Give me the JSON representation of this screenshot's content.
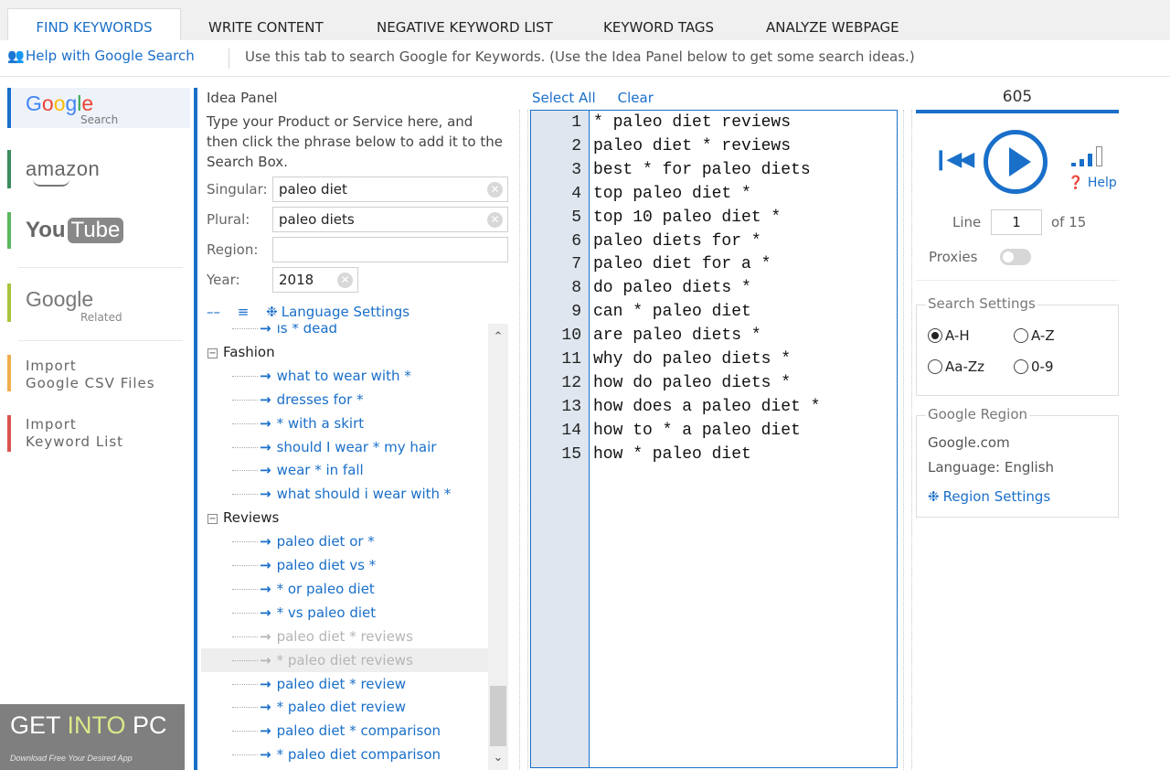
{
  "tabs": [
    "FIND KEYWORDS",
    "WRITE CONTENT",
    "NEGATIVE KEYWORD LIST",
    "KEYWORD TAGS",
    "ANALYZE WEBPAGE"
  ],
  "help": {
    "link": "Help with Google Search",
    "hint": "Use this tab to search Google for Keywords. (Use the Idea Panel below to get some search ideas.)"
  },
  "nav": {
    "google_sub": "Search",
    "amazon": "amazon",
    "youtube_you": "You",
    "youtube_tube": "Tube",
    "google_related": "Google",
    "google_related_sub": "Related",
    "import_csv": "Import\nGoogle CSV Files",
    "import_list": "Import\nKeyword List",
    "colors": {
      "google": "#1a6fc9",
      "amazon": "#3a8c5c",
      "youtube": "#5cb85c",
      "related": "#a8c43a",
      "csv": "#f0ad4e",
      "list": "#d9534f"
    }
  },
  "watermark": {
    "get": "GET ",
    "into": "INTO",
    "pc": " PC",
    "sub": "Download Free Your Desired App"
  },
  "idea_panel": {
    "title": "Idea Panel",
    "description": "Type your Product or Service here, and then click the phrase below to add it to the Search Box.",
    "singular_label": "Singular:",
    "singular_value": "paleo diet",
    "plural_label": "Plural:",
    "plural_value": "paleo diets",
    "region_label": "Region:",
    "region_value": "",
    "year_label": "Year:",
    "year_value": "2018",
    "language_settings": "Language Settings",
    "tree": [
      {
        "kind": "leaf",
        "text": "is * dead",
        "dim": false
      },
      {
        "kind": "cat",
        "text": "Fashion"
      },
      {
        "kind": "leaf",
        "text": "what to wear with *",
        "dim": false
      },
      {
        "kind": "leaf",
        "text": "dresses for *",
        "dim": false
      },
      {
        "kind": "leaf",
        "text": "* with a skirt",
        "dim": false
      },
      {
        "kind": "leaf",
        "text": "should I wear * my hair",
        "dim": false
      },
      {
        "kind": "leaf",
        "text": "wear * in fall",
        "dim": false
      },
      {
        "kind": "leaf",
        "text": "what should i wear with *",
        "dim": false
      },
      {
        "kind": "cat",
        "text": "Reviews"
      },
      {
        "kind": "leaf",
        "text": "paleo diet or *",
        "dim": false
      },
      {
        "kind": "leaf",
        "text": "paleo diet vs *",
        "dim": false
      },
      {
        "kind": "leaf",
        "text": "* or paleo diet",
        "dim": false
      },
      {
        "kind": "leaf",
        "text": "* vs paleo diet",
        "dim": false
      },
      {
        "kind": "leaf",
        "text": "paleo diet * reviews",
        "dim": true
      },
      {
        "kind": "leaf",
        "text": "* paleo diet reviews",
        "dim": true,
        "hover": true
      },
      {
        "kind": "leaf",
        "text": "paleo diet * review",
        "dim": false
      },
      {
        "kind": "leaf",
        "text": "* paleo diet review",
        "dim": false
      },
      {
        "kind": "leaf",
        "text": "paleo diet * comparison",
        "dim": false
      },
      {
        "kind": "leaf",
        "text": "* paleo diet comparison",
        "dim": false
      }
    ]
  },
  "editor": {
    "select_all": "Select All",
    "clear": "Clear",
    "lines": [
      "* paleo diet reviews",
      "paleo diet * reviews",
      "best * for paleo diets",
      "top paleo diet *",
      "top 10 paleo diet *",
      "paleo diets for *",
      "paleo diet for a *",
      "do paleo diets *",
      "can * paleo diet",
      "are paleo diets *",
      "why do paleo diets *",
      "how do paleo diets *",
      "how does a paleo diet *",
      "how to * a paleo diet",
      "how * paleo diet"
    ]
  },
  "right_panel": {
    "count": "605",
    "help": "Help",
    "line_label": "Line",
    "line_value": "1",
    "line_of": "of 15",
    "proxies_label": "Proxies",
    "proxies_on": false,
    "search_settings_title": "Search Settings",
    "sort_options": [
      {
        "label": "A-H",
        "selected": true
      },
      {
        "label": "A-Z",
        "selected": false
      },
      {
        "label": "Aa-Zz",
        "selected": false
      },
      {
        "label": "0-9",
        "selected": false
      }
    ],
    "google_region_title": "Google Region",
    "region_domain": "Google.com",
    "region_language": "Language: English",
    "region_settings": "Region Settings"
  },
  "accent_color": "#1a6fc9"
}
